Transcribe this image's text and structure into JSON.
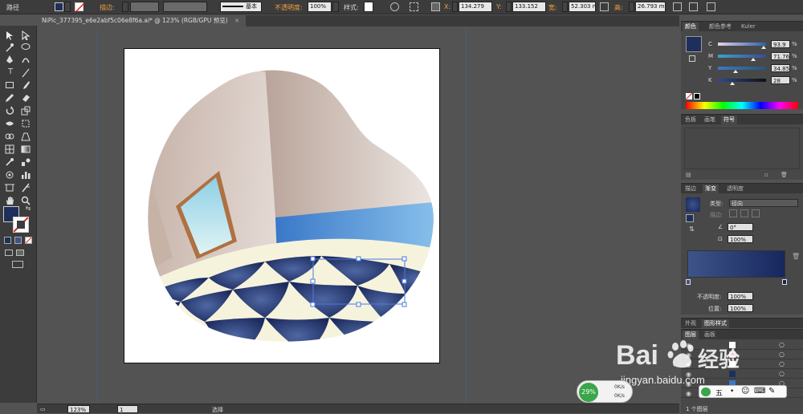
{
  "control_bar": {
    "selection_label": "路径",
    "stroke_label": "描边:",
    "stroke_style": "基本",
    "opacity_label": "不透明度:",
    "opacity_value": "100%",
    "style_label": "样式:",
    "x_label": "X:",
    "x_value": "134.279",
    "y_label": "Y:",
    "y_value": "133.152",
    "w_label": "宽:",
    "w_value": "52.303 m",
    "h_label": "高:",
    "h_value": "26.793 m",
    "fill_color": "#1e2f5c"
  },
  "document_tab": {
    "title": "NiPic_377395_e6e2abf5c06e8f6a.ai* @ 123% (RGB/GPU 预览)"
  },
  "color_panel": {
    "tabs": [
      "颜色",
      "颜色参考",
      "Kuler"
    ],
    "active_tab": "颜色",
    "swatch_color": "#1e2f5c",
    "channels": [
      {
        "label": "C",
        "value": "93.9",
        "level": 0.939
      },
      {
        "label": "M",
        "value": "71.76",
        "level": 0.7176
      },
      {
        "label": "Y",
        "value": "34.85",
        "level": 0.3485
      },
      {
        "label": "K",
        "value": "28",
        "level": 0.28
      }
    ]
  },
  "swatches_panel": {
    "tabs": [
      "色板",
      "画笔",
      "符号"
    ],
    "active_tab": "符号"
  },
  "gradient_panel": {
    "tabs": [
      "描边",
      "渐变",
      "透明度"
    ],
    "active_tab": "渐变",
    "type_label": "类型:",
    "type_value": "径向",
    "stroke_label": "描边:",
    "angle_value": "0°",
    "ratio_value": "100%",
    "opacity_label": "不透明度:",
    "opacity_value": "100%",
    "position_label": "位置:",
    "position_value": "100%",
    "gradient_start": "#3e5489",
    "gradient_end": "#16275e"
  },
  "appearance_panel": {
    "tabs": [
      "外观",
      "图形样式"
    ],
    "active_tab": "图形样式"
  },
  "layers_panel": {
    "tabs": [
      "图层",
      "画板"
    ],
    "active_tab": "图层",
    "footer_label": "1 个图层"
  },
  "status_bar": {
    "zoom": "123%",
    "page": "1",
    "tool_label": "选择"
  },
  "watermark": {
    "brand_text": "Bai",
    "brand_cn": "经验",
    "url": "jingyan.baidu.com"
  },
  "speed_widget": {
    "percent": "29%",
    "speed": "0K/s",
    "speed2": "0K/s"
  },
  "ime_bar": {
    "mode_label": "五"
  }
}
